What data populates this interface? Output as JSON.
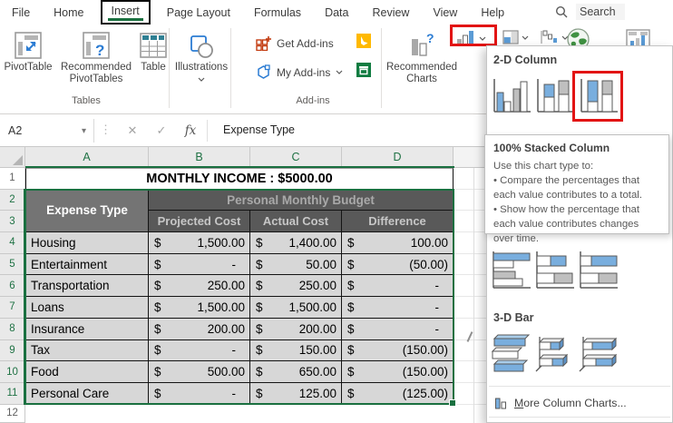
{
  "tabs": {
    "items": [
      "File",
      "Home",
      "Insert",
      "Page Layout",
      "Formulas",
      "Data",
      "Review",
      "View",
      "Help"
    ],
    "active": "Insert",
    "search_label": "Search"
  },
  "ribbon": {
    "tables": {
      "buttons": [
        "PivotTable",
        "Recommended PivotTables",
        "Table"
      ],
      "label": "Tables"
    },
    "illustrations": {
      "button": "Illustrations"
    },
    "addins": {
      "get_label": "Get Add-ins",
      "my_label": "My Add-ins",
      "label": "Add-ins"
    },
    "charts": {
      "recommended_label": "Recommended Charts"
    }
  },
  "formula_bar": {
    "name_box": "A2",
    "formula_text": "Expense Type",
    "cancel_glyph": "✕",
    "enter_glyph": "✓",
    "fx_label": "fx"
  },
  "dropdown": {
    "section_2d": "2-D Column",
    "section_3d": "3-D Bar",
    "footer_label": "More Column Charts...",
    "thumbnails_2d": [
      "clustered-column",
      "stacked-column",
      "100-stacked-column"
    ],
    "thumbnails_bar": [
      "clustered-bar",
      "stacked-bar",
      "100-stacked-bar"
    ],
    "thumbnails_3d": [
      "clustered-bar-3d",
      "stacked-bar-3d",
      "100-stacked-bar-3d"
    ],
    "selected_thumbnail": "100-stacked-column",
    "tooltip": {
      "title": "100% Stacked Column",
      "intro": "Use this chart type to:",
      "bullets": [
        "• Compare the percentages that each value contributes to a total.",
        "• Show how the percentage that each value contributes changes over time."
      ]
    }
  },
  "sheet": {
    "column_headers": [
      "A",
      "B",
      "C",
      "D"
    ],
    "visible_rows": [
      1,
      2,
      3,
      4,
      5,
      6,
      7,
      8,
      9,
      10,
      11,
      12
    ],
    "active_cell": "A2",
    "title": "MONTHLY INCOME : $5000.00",
    "currency": "$",
    "header": {
      "expense": "Expense Type",
      "budget": "Personal Monthly Budget",
      "subheaders": [
        "Projected Cost",
        "Actual Cost",
        "Difference"
      ]
    },
    "rows": [
      {
        "name": "Housing",
        "projected": "1,500.00",
        "actual": "1,400.00",
        "difference": "100.00"
      },
      {
        "name": "Entertainment",
        "projected": "-",
        "actual": "50.00",
        "difference": "(50.00)"
      },
      {
        "name": "Transportation",
        "projected": "250.00",
        "actual": "250.00",
        "difference": "-"
      },
      {
        "name": "Loans",
        "projected": "1,500.00",
        "actual": "1,500.00",
        "difference": "-"
      },
      {
        "name": "Insurance",
        "projected": "200.00",
        "actual": "200.00",
        "difference": "-"
      },
      {
        "name": "Tax",
        "projected": "-",
        "actual": "150.00",
        "difference": "(150.00)"
      },
      {
        "name": "Food",
        "projected": "500.00",
        "actual": "650.00",
        "difference": "(150.00)"
      },
      {
        "name": "Personal Care",
        "projected": "-",
        "actual": "125.00",
        "difference": "(125.00)"
      }
    ]
  },
  "colors": {
    "excel_green": "#217346",
    "selection_green": "#1a7040",
    "accent_blue": "#5b9bd5",
    "thumb_blue": "#79aede",
    "thumb_gray": "#bfbfbf",
    "header_dark": "#595959",
    "header_medium": "#747474",
    "row_fill": "#d7d7d7",
    "highlight_red": "#e21414"
  }
}
